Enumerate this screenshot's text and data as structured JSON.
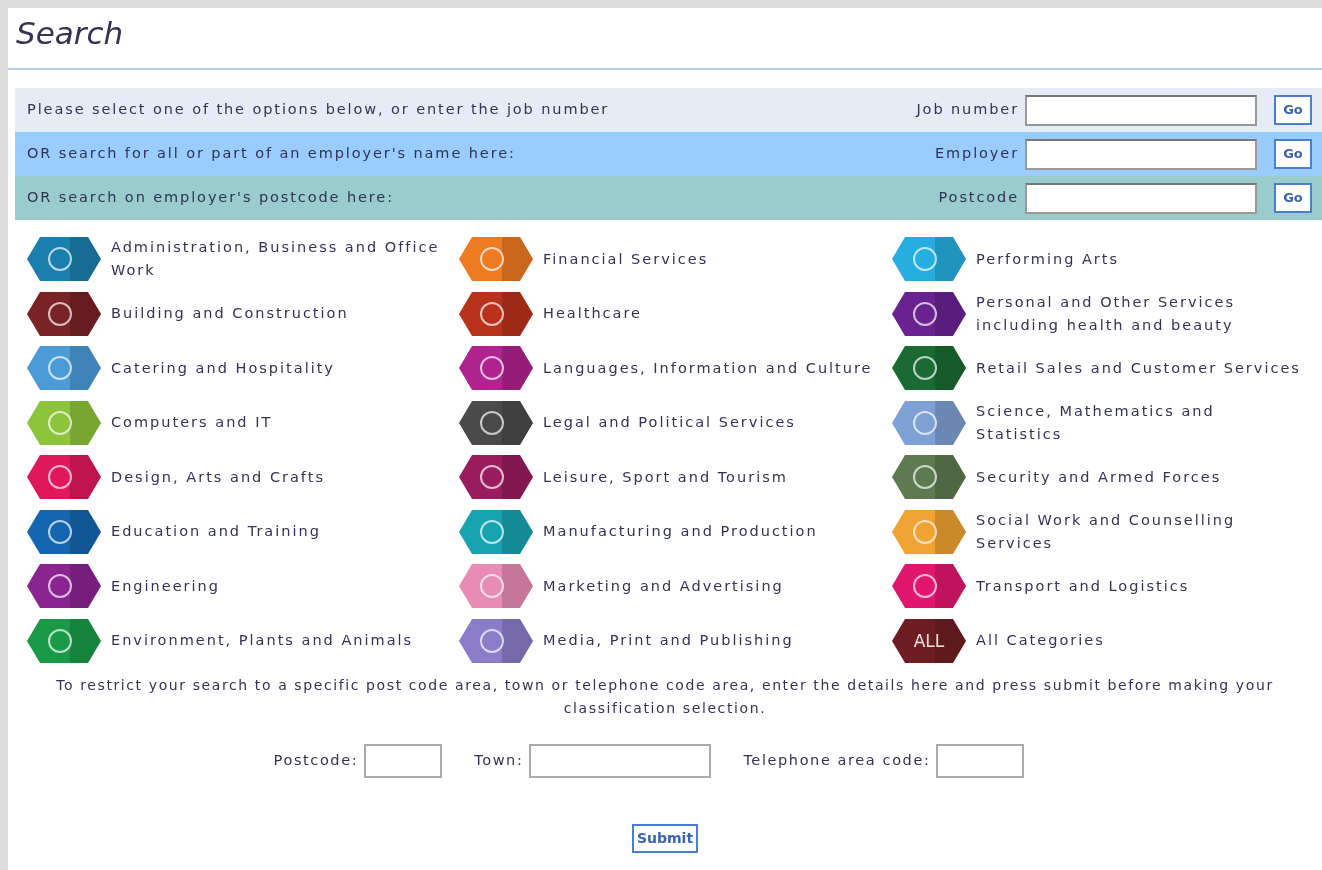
{
  "title": "Search",
  "search_rows": [
    {
      "text": "Please select one of the options below, or enter the job number",
      "label": "Job number",
      "button": "Go",
      "color": "#e6ecf5"
    },
    {
      "text": "OR search for all or part of an employer's name here:",
      "label": "Employer",
      "button": "Go",
      "color": "#99ccff"
    },
    {
      "text": "OR search on employer's postcode here:",
      "label": "Postcode",
      "button": "Go",
      "color": "#99cccc"
    }
  ],
  "category_columns": [
    {
      "items": [
        {
          "label": "Administration, Business and Office Work",
          "color": "#1a7fae"
        },
        {
          "label": "Building and Construction",
          "color": "#7a2326"
        },
        {
          "label": "Catering and Hospitality",
          "color": "#4a9bd6"
        },
        {
          "label": "Computers and IT",
          "color": "#8cc43c"
        },
        {
          "label": "Design, Arts and Crafts",
          "color": "#e0175a"
        },
        {
          "label": "Education and Training",
          "color": "#1466b0"
        },
        {
          "label": "Engineering",
          "color": "#8a2491"
        },
        {
          "label": "Environment, Plants and Animals",
          "color": "#1a9a48"
        }
      ]
    },
    {
      "items": [
        {
          "label": "Financial Services",
          "color": "#ee7a22"
        },
        {
          "label": "Healthcare",
          "color": "#b8321c"
        },
        {
          "label": "Languages, Information and Culture",
          "color": "#b0228e"
        },
        {
          "label": "Legal and Political Services",
          "color": "#4a4a4a"
        },
        {
          "label": "Leisure, Sport and Tourism",
          "color": "#9a1c5e"
        },
        {
          "label": "Manufacturing and Production",
          "color": "#17a3b0"
        },
        {
          "label": "Marketing and Advertising",
          "color": "#e88cb4"
        },
        {
          "label": "Media, Print and Publishing",
          "color": "#8a7cc8"
        }
      ]
    },
    {
      "items": [
        {
          "label": "Performing Arts",
          "color": "#26aee0"
        },
        {
          "label": "Personal and Other Services including health and beauty",
          "color": "#6a2290"
        },
        {
          "label": "Retail Sales and Customer Services",
          "color": "#1a6a34"
        },
        {
          "label": "Science, Mathematics and Statistics",
          "color": "#7ea0d4"
        },
        {
          "label": "Security and Armed Forces",
          "color": "#5e7a50"
        },
        {
          "label": "Social Work and Counselling Services",
          "color": "#f0a232"
        },
        {
          "label": "Transport and Logistics",
          "color": "#e2166e"
        },
        {
          "label": "All Categories",
          "color": "#6e1e22",
          "icon_text": "ALL"
        }
      ]
    }
  ],
  "restrict_note": "To restrict your search to a specific post code area, town or telephone code area, enter the details here and press submit before making your classification selection.",
  "restrict_fields": [
    {
      "label": "Postcode:"
    },
    {
      "label": "Town:"
    },
    {
      "label": "Telephone area code:"
    }
  ],
  "submit": "Submit"
}
